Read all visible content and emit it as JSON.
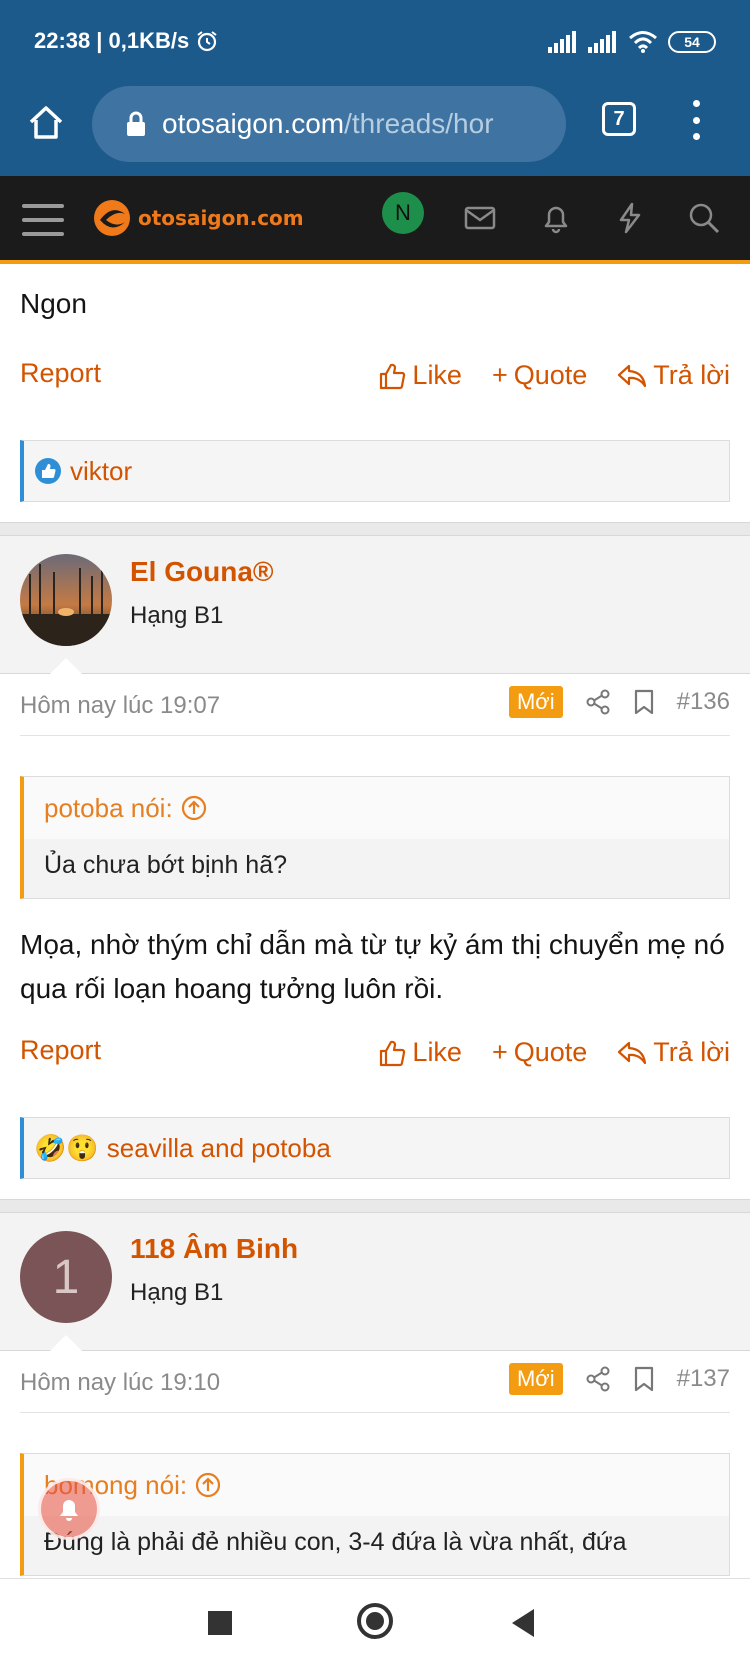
{
  "status": {
    "time": "22:38",
    "speed": "| 0,1KB/s",
    "battery": "54"
  },
  "browser": {
    "url_host": "otosaigon.com",
    "url_path": "/threads/hor",
    "tab_count": "7"
  },
  "site": {
    "logo_text": "otosaigon.com",
    "user_initial": "N"
  },
  "top_post": {
    "text": "Ngon",
    "reactions": "viktor"
  },
  "actions": {
    "report": "Report",
    "like": "Like",
    "quote": "Quote",
    "reply": "Trả lời"
  },
  "post136": {
    "username": "El Gouna®",
    "user_title": "Hạng B1",
    "time": "Hôm nay lúc 19:07",
    "badge": "Mới",
    "number": "#136",
    "quote_author": "potoba nói:",
    "quote_text": "Ủa chưa bớt bịnh hã?",
    "text": "Mọa, nhờ thým chỉ dẫn mà từ tự kỷ ám thị chuyển mẹ nó qua rối loạn hoang tưởng luôn rồi.",
    "reactions": "seavilla and potoba"
  },
  "post137": {
    "username": "118 Âm Binh",
    "user_title": "Hạng B1",
    "avatar_letter": "1",
    "time": "Hôm nay lúc 19:10",
    "badge": "Mới",
    "number": "#137",
    "quote_author": "bomong nói:",
    "quote_text": "Đúng là phải đẻ nhiều con, 3-4 đứa là vừa nhất, đứa"
  },
  "colors": {
    "brand": "#d35400",
    "accent": "#f39c12",
    "chrome": "#1d5a8c",
    "header": "#1b1b1b"
  }
}
